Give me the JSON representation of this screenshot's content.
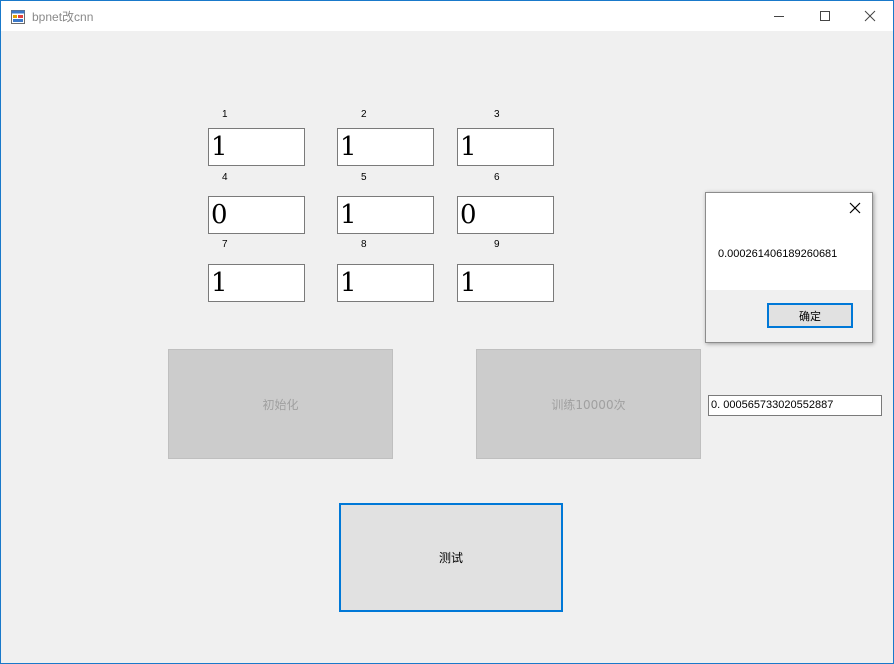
{
  "window": {
    "title": "bpnet改cnn",
    "accent_color": "#0078d7"
  },
  "titlebar_icons": {
    "app": "app-form-icon",
    "minimize": "minimize-icon",
    "maximize": "maximize-icon",
    "close": "close-icon"
  },
  "grid": {
    "labels": [
      "1",
      "2",
      "3",
      "4",
      "5",
      "6",
      "7",
      "8",
      "9"
    ],
    "values": [
      "1",
      "1",
      "1",
      "0",
      "1",
      "0",
      "1",
      "1",
      "1"
    ]
  },
  "buttons": {
    "init_label": "初始化",
    "train_label": "训练10000次",
    "test_label": "测试"
  },
  "result": {
    "value": "0. 000565733020552887"
  },
  "dialog": {
    "message": "0.000261406189260681",
    "ok_label": "确定"
  }
}
